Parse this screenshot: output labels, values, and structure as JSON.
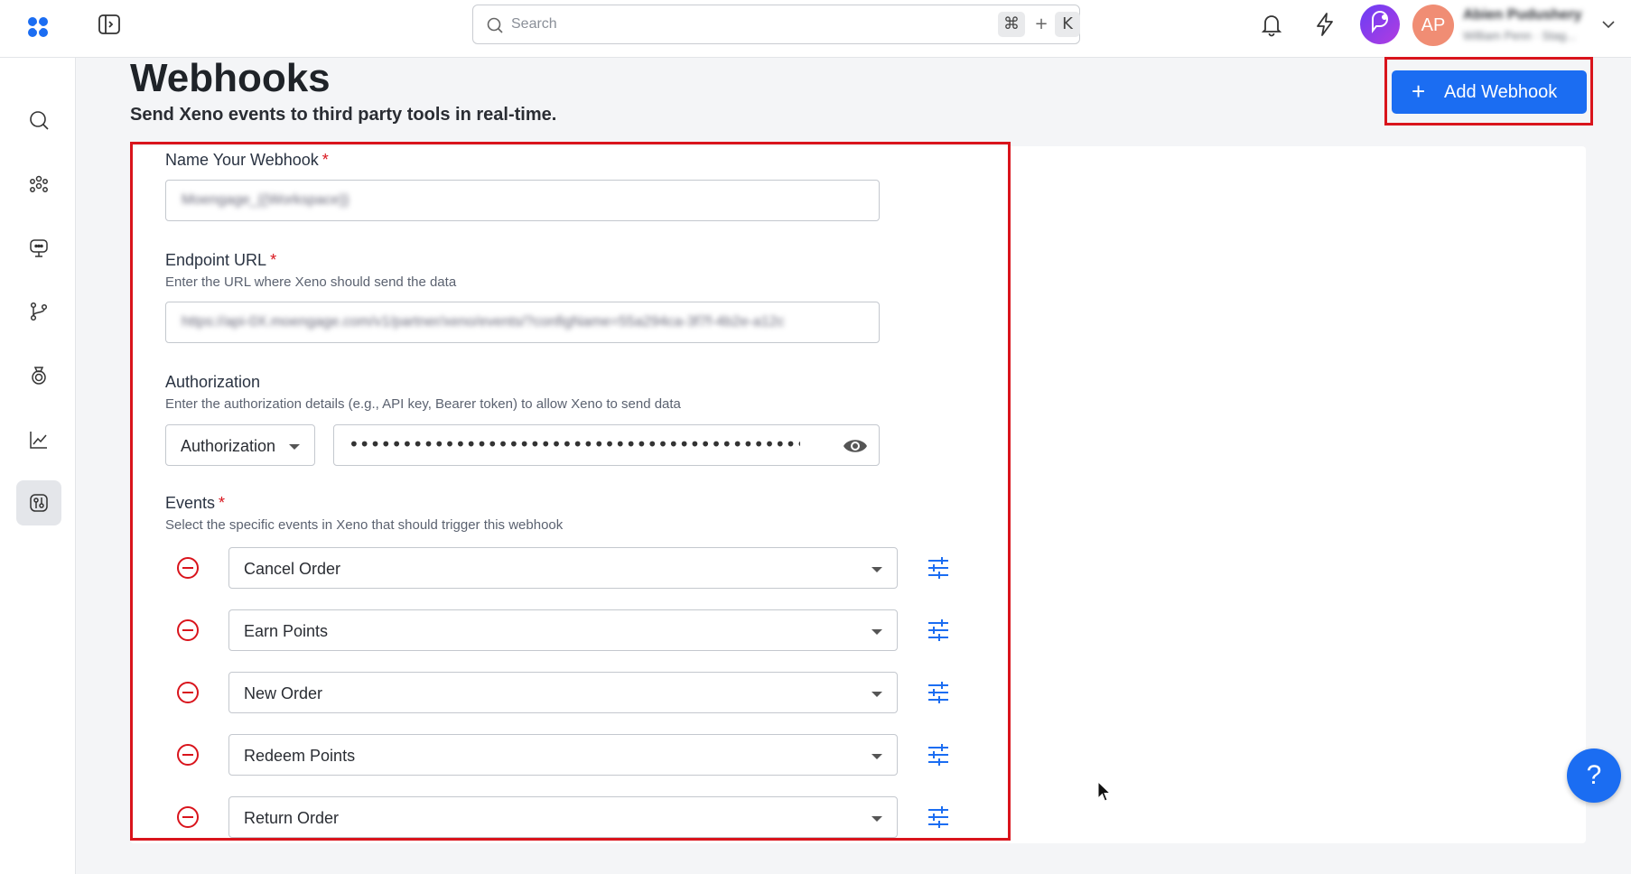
{
  "search": {
    "placeholder": "Search",
    "shortcut_cmd": "⌘",
    "shortcut_plus": "+",
    "shortcut_key": "K"
  },
  "user": {
    "initials": "AP",
    "name": "Abien Pudushery",
    "subtitle": "William Penn · Stag..."
  },
  "page": {
    "title": "Webhooks",
    "subtitle": "Send Xeno events to third party tools in real-time."
  },
  "actions": {
    "add_webhook": "Add Webhook"
  },
  "form": {
    "name": {
      "label": "Name Your Webhook",
      "required": "*",
      "value": "Moengage_{{Workspace}}"
    },
    "endpoint": {
      "label": "Endpoint URL",
      "required": "*",
      "help": "Enter the URL where Xeno should send the data",
      "value": "https://api-0X.moengage.com/v1/partner/xeno/events/?configName=55a294ca-3f7f-4b2e-a12c"
    },
    "authorization": {
      "label": "Authorization",
      "help": "Enter the authorization details (e.g., API key, Bearer token) to allow Xeno to send data",
      "type": "Authorization",
      "masked_value": "••••••••••••••••••••••••••••••••••••••••••••••••••••••••••••••••••••••••••••••••"
    },
    "events": {
      "label": "Events",
      "required": "*",
      "help": "Select the specific events in Xeno that should trigger this webhook",
      "items": [
        {
          "name": "Cancel Order"
        },
        {
          "name": "Earn Points"
        },
        {
          "name": "New Order"
        },
        {
          "name": "Redeem Points"
        },
        {
          "name": "Return Order"
        }
      ]
    }
  },
  "help_fab": "?",
  "colors": {
    "primary": "#1b6df2",
    "danger": "#d9141c",
    "avatar": "#f08d74"
  },
  "icons": [
    "logo-icon",
    "panel-toggle-icon",
    "search-icon",
    "bell-icon",
    "lightning-icon",
    "assistant-icon",
    "chevron-down-icon",
    "sidebar-search-icon",
    "audience-icon",
    "campaigns-icon",
    "journeys-icon",
    "loyalty-icon",
    "analytics-icon",
    "integrations-icon",
    "eye-icon",
    "remove-circle-icon",
    "sliders-icon",
    "cursor-icon"
  ]
}
